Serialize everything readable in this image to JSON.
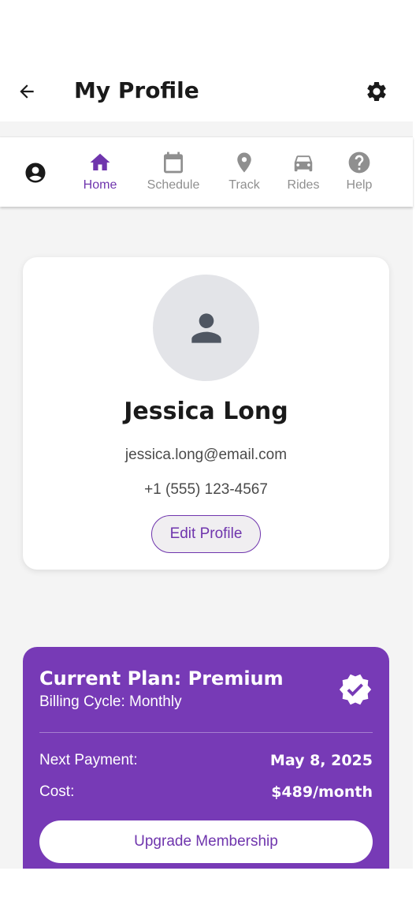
{
  "app_bar": {
    "title": "My Profile",
    "back_icon": "arrow-left-icon",
    "settings_icon": "gear-icon"
  },
  "nav": {
    "avatar_icon": "account-circle-icon",
    "items": [
      {
        "label": "Home",
        "icon": "home-icon",
        "active": true
      },
      {
        "label": "Schedule",
        "icon": "calendar-icon",
        "active": false
      },
      {
        "label": "Track",
        "icon": "location-pin-icon",
        "active": false
      },
      {
        "label": "Rides",
        "icon": "car-icon",
        "active": false
      },
      {
        "label": "Help",
        "icon": "help-circle-icon",
        "active": false
      }
    ]
  },
  "profile": {
    "name": "Jessica Long",
    "email": "jessica.long@email.com",
    "phone": "+1 (555) 123-4567",
    "edit_label": "Edit Profile",
    "avatar_icon": "person-icon"
  },
  "plan": {
    "title": "Current Plan: Premium",
    "billing": "Billing Cycle: Monthly",
    "badge_icon": "verified-badge-icon",
    "next_payment_label": "Next Payment:",
    "next_payment_value": "May 8, 2025",
    "cost_label": "Cost:",
    "cost_value": "$489/month",
    "upgrade_label": "Upgrade Membership"
  },
  "colors": {
    "accent": "#773ab6",
    "accent_text": "#6f35ad",
    "inactive": "#8f8f8f",
    "background": "#f4f4f4"
  }
}
